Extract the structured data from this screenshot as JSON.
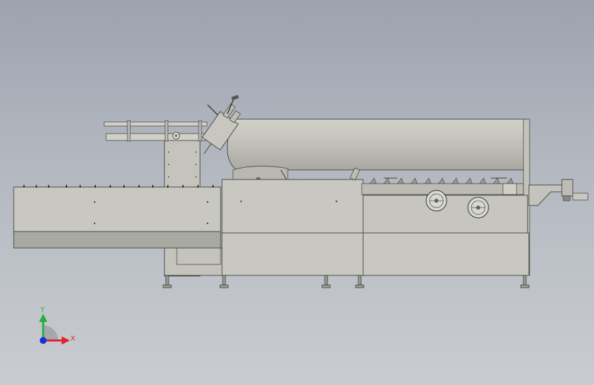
{
  "triad": {
    "y_label": "Y",
    "x_label": "X"
  },
  "colors": {
    "body": "#c7c7be",
    "body_dark": "#a9aaa2",
    "outline": "#4a4a46",
    "x_axis": "#e0242b",
    "y_axis": "#22b03a",
    "z_axis": "#1030e0"
  }
}
